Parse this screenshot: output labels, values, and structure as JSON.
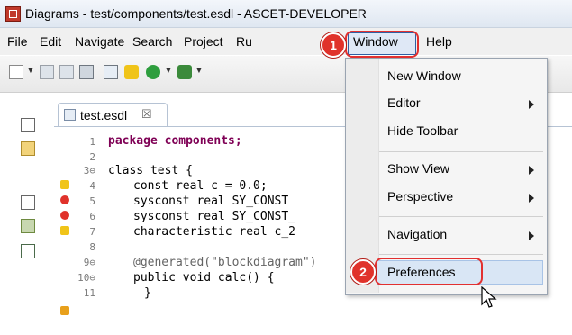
{
  "window": {
    "title": "Diagrams - test/components/test.esdl - ASCET-DEVELOPER"
  },
  "menubar": {
    "items": [
      {
        "label": "File"
      },
      {
        "label": "Edit"
      },
      {
        "label": "Navigate"
      },
      {
        "label": "Search"
      },
      {
        "label": "Project"
      },
      {
        "label": "Ru"
      },
      {
        "label": "Window"
      },
      {
        "label": "Help"
      }
    ]
  },
  "editor": {
    "tab_label": "test.esdl",
    "tab_close_glyph": "☒",
    "lines": [
      {
        "num": "1",
        "text": "package components;"
      },
      {
        "num": "2",
        "text": ""
      },
      {
        "num": "3⊖",
        "text": "class test {"
      },
      {
        "num": "4",
        "text": "const real c = 0.0;"
      },
      {
        "num": "5",
        "text": "sysconst real SY_CONST"
      },
      {
        "num": "6",
        "text": "sysconst real SY_CONST_"
      },
      {
        "num": "7",
        "text": "characteristic real c_2"
      },
      {
        "num": "8",
        "text": ""
      },
      {
        "num": "9⊖",
        "text": "@generated(\"blockdiagram\")"
      },
      {
        "num": "10⊖",
        "text": "public void calc() {"
      },
      {
        "num": "11",
        "text": "}"
      }
    ]
  },
  "window_menu": {
    "items": [
      {
        "label": "New Window",
        "submenu": false
      },
      {
        "label": "Editor",
        "submenu": true
      },
      {
        "label": "Hide Toolbar",
        "submenu": false
      },
      {
        "label": "Show View",
        "submenu": true
      },
      {
        "label": "Perspective",
        "submenu": true
      },
      {
        "label": "Navigation",
        "submenu": true
      },
      {
        "label": "Preferences",
        "submenu": false
      }
    ]
  },
  "callouts": [
    {
      "number": "1"
    },
    {
      "number": "2"
    }
  ],
  "colors": {
    "callout_red": "#e0322b",
    "keyword": "#7f0055",
    "string": "#2a00ff",
    "menu_highlight": "#d9e6f5"
  },
  "icons": [
    "app-icon",
    "new-file-icon",
    "save-icon",
    "save-all-icon",
    "print-icon",
    "build-icon",
    "run-icon",
    "debug-icon",
    "close-icon",
    "submenu-arrow-icon",
    "error-icon",
    "warning-icon",
    "mouse-cursor-icon"
  ]
}
